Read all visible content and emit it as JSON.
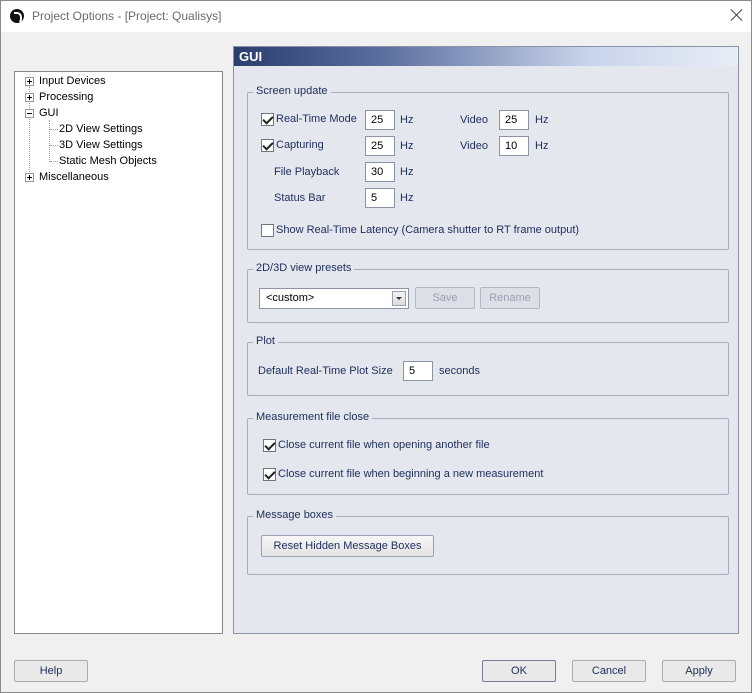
{
  "window": {
    "title": "Project Options - [Project: Qualisys]"
  },
  "tree": {
    "items": [
      {
        "label": "Input Devices",
        "expander": "+"
      },
      {
        "label": "Processing",
        "expander": "+"
      },
      {
        "label": "GUI",
        "expander": "-"
      },
      {
        "label": "2D View Settings"
      },
      {
        "label": "3D View Settings"
      },
      {
        "label": "Static Mesh Objects"
      },
      {
        "label": "Miscellaneous",
        "expander": "+"
      }
    ]
  },
  "panel": {
    "title": "GUI",
    "screen_update": {
      "legend": "Screen update",
      "realtime_label": "Real-Time Mode",
      "realtime_checked": true,
      "realtime_value": "25",
      "realtime_video_label": "Video",
      "realtime_video_value": "25",
      "capturing_label": "Capturing",
      "capturing_checked": true,
      "capturing_value": "25",
      "capturing_video_label": "Video",
      "capturing_video_value": "10",
      "file_playback_label": "File Playback",
      "file_playback_value": "30",
      "status_bar_label": "Status Bar",
      "status_bar_value": "5",
      "unit": "Hz",
      "latency_label": "Show Real-Time Latency (Camera shutter to RT frame output)",
      "latency_checked": false
    },
    "presets": {
      "legend": "2D/3D view presets",
      "selected": "<custom>",
      "save_label": "Save",
      "rename_label": "Rename"
    },
    "plot": {
      "legend": "Plot",
      "size_label": "Default Real-Time Plot Size",
      "size_value": "5",
      "unit": "seconds"
    },
    "measurement_close": {
      "legend": "Measurement file close",
      "opt1_label": "Close current file when opening another file",
      "opt1_checked": true,
      "opt2_label": "Close current file when beginning a new measurement",
      "opt2_checked": true
    },
    "message_boxes": {
      "legend": "Message boxes",
      "reset_label": "Reset Hidden Message Boxes"
    }
  },
  "footer": {
    "help_label": "Help",
    "ok_label": "OK",
    "cancel_label": "Cancel",
    "apply_label": "Apply"
  }
}
